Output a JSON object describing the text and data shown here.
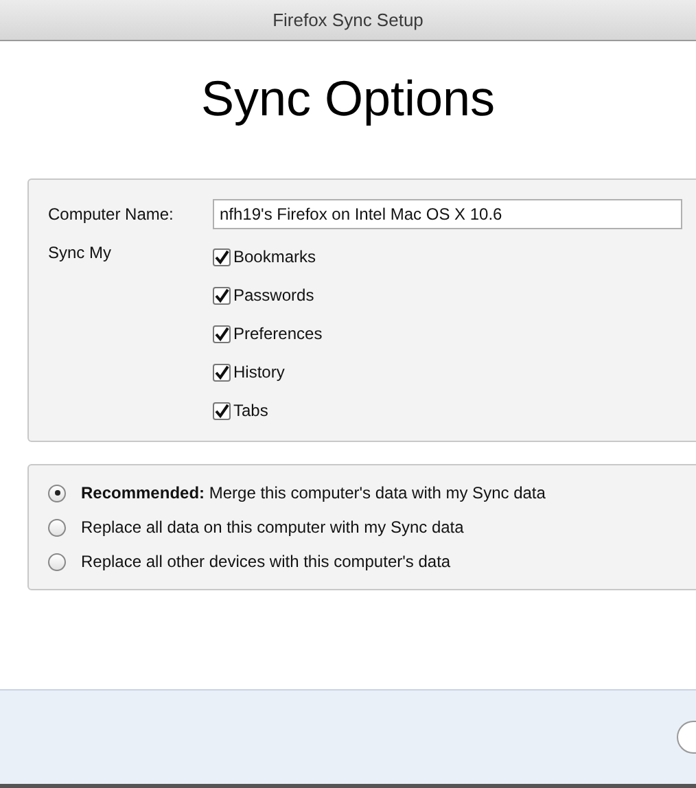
{
  "window": {
    "title": "Firefox Sync Setup"
  },
  "heading": "Sync Options",
  "computer_name": {
    "label": "Computer Name:",
    "value": "nfh19's Firefox on Intel Mac OS X 10.6"
  },
  "sync_my": {
    "label": "Sync My",
    "items": [
      {
        "label": "Bookmarks",
        "checked": true
      },
      {
        "label": "Passwords",
        "checked": true
      },
      {
        "label": "Preferences",
        "checked": true
      },
      {
        "label": "History",
        "checked": true
      },
      {
        "label": "Tabs",
        "checked": true
      }
    ]
  },
  "merge_options": [
    {
      "label": "**Recommended:** Merge this computer's data with my Sync data",
      "selected": true
    },
    {
      "label": "Replace all data on this computer with my Sync data",
      "selected": false
    },
    {
      "label": "Replace all other devices with this computer's data",
      "selected": false
    }
  ]
}
